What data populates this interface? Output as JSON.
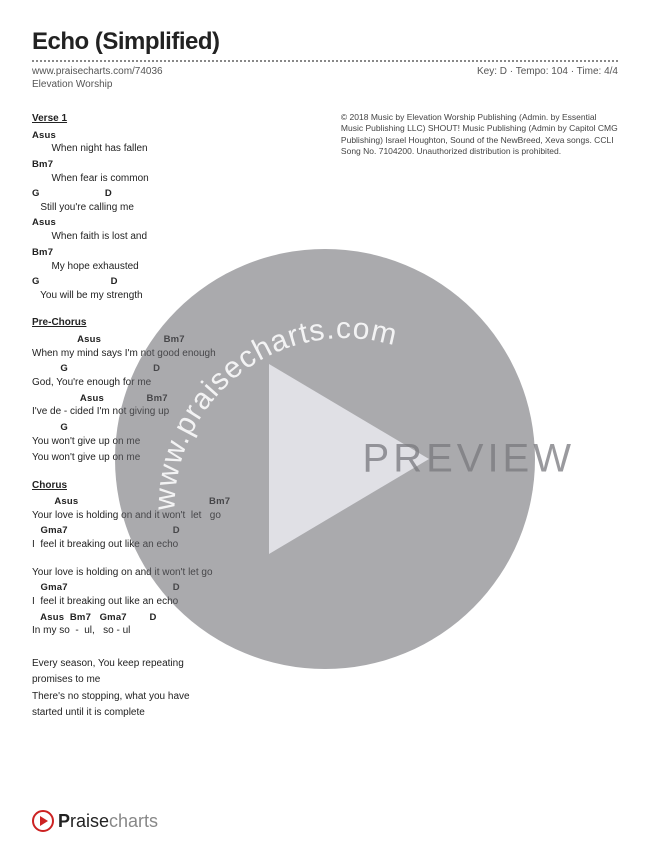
{
  "header": {
    "title": "Echo (Simplified)",
    "url": "www.praisecharts.com/74036",
    "meta": "Key: D · Tempo: 104 · Time: 4/4",
    "artist": "Elevation Worship"
  },
  "copyright": "© 2018 Music by Elevation Worship Publishing (Admin. by Essential Music Publishing LLC) SHOUT! Music Publishing (Admin by Capitol CMG Publishing) Israel Houghton, Sound of the NewBreed, Xeva songs. CCLI Song No. 7104200. Unauthorized distribution is prohibited.",
  "sections": {
    "verse1": {
      "label": "Verse 1",
      "lines": [
        {
          "chords": "Asus",
          "lyric": "       When night has fallen"
        },
        {
          "chords": "Bm7",
          "lyric": "       When fear is common"
        },
        {
          "chords": "G                       D",
          "lyric": "   Still you're calling me"
        },
        {
          "chords": "Asus",
          "lyric": "       When faith is lost and"
        },
        {
          "chords": "Bm7",
          "lyric": "       My hope exhausted"
        },
        {
          "chords": "G                         D",
          "lyric": "   You will be my strength"
        }
      ]
    },
    "prechorus": {
      "label": "Pre-Chorus",
      "lines": [
        {
          "chords": "                Asus                      Bm7",
          "lyric": "When my mind says I'm not good enough"
        },
        {
          "chords": "          G                              D",
          "lyric": "God, You're enough for me"
        },
        {
          "chords": "                 Asus               Bm7",
          "lyric": "I've de - cided I'm not giving up"
        },
        {
          "chords": "          G",
          "lyric": "You won't give up on me"
        },
        {
          "chords": "",
          "lyric": "You won't give up on me"
        }
      ]
    },
    "chorus": {
      "label": "Chorus",
      "lines": [
        {
          "chords": "        Asus                                              Bm7",
          "lyric": "Your love is holding on and it won't  let   go"
        },
        {
          "chords": "   Gma7                                     D",
          "lyric": "I  feel it breaking out like an echo"
        },
        {
          "chords": "",
          "lyric": ""
        },
        {
          "chords": "",
          "lyric": "Your love is holding on and it won't let go"
        },
        {
          "chords": "   Gma7                                     D",
          "lyric": "I  feel it breaking out like an echo"
        },
        {
          "chords": "   Asus  Bm7   Gma7        D",
          "lyric": "In my so  -  ul,   so - ul"
        }
      ]
    },
    "bridge": {
      "lines": [
        {
          "lyric": "Every season, You keep repeating"
        },
        {
          "lyric": "promises to me"
        },
        {
          "lyric": "There's no stopping, what you have"
        },
        {
          "lyric": "started until it is complete"
        }
      ]
    }
  },
  "watermark": {
    "arc_text": "www.praisecharts.com",
    "preview": "PREVIEW"
  },
  "footer": {
    "brand_p": "P",
    "brand_rest_dark": "raise",
    "brand_rest_light": "charts"
  },
  "chart_data": {
    "type": "table",
    "title": "Echo (Simplified) — Chord Chart",
    "key": "D",
    "tempo": 104,
    "time_signature": "4/4",
    "artist": "Elevation Worship",
    "sections": [
      {
        "name": "Verse 1",
        "progression": [
          "Asus",
          "Bm7",
          "G",
          "D",
          "Asus",
          "Bm7",
          "G",
          "D"
        ]
      },
      {
        "name": "Pre-Chorus",
        "progression": [
          "Asus",
          "Bm7",
          "G",
          "D",
          "Asus",
          "Bm7",
          "G"
        ]
      },
      {
        "name": "Chorus",
        "progression": [
          "Asus",
          "Bm7",
          "Gma7",
          "D",
          "Gma7",
          "D",
          "Asus",
          "Bm7",
          "Gma7",
          "D"
        ]
      }
    ]
  }
}
